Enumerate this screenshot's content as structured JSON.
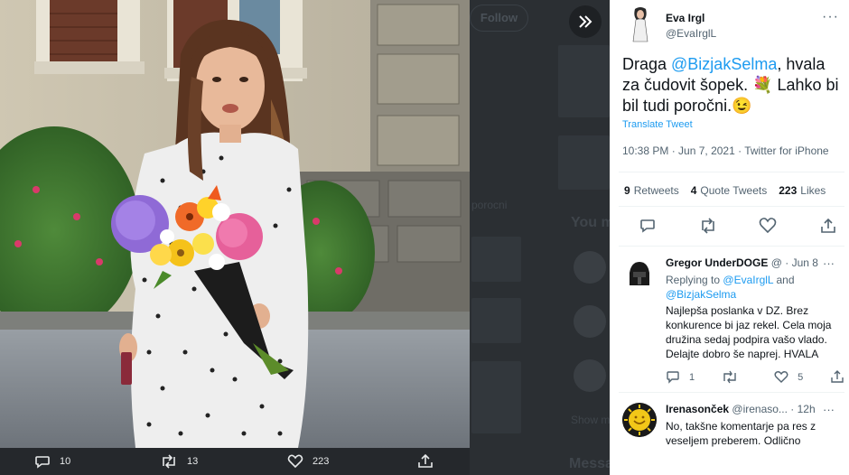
{
  "overlay": {
    "background_follow_label": "Follow",
    "background_text_1": "You m",
    "background_text_2": "Show m",
    "background_text_3": "Messa",
    "background_text_4": "porocni"
  },
  "media_bar": {
    "reply_count": "10",
    "retweet_count": "13",
    "like_count": "223"
  },
  "tweet": {
    "author_name": "Eva Irgl",
    "author_handle": "@EvaIrglL",
    "text_before": "Draga ",
    "mention": "@BizjakSelma",
    "text_after": ", hvala za čudovit šopek. 💐 Lahko bi bil tudi poročni.😉",
    "translate_label": "Translate Tweet",
    "time": "10:38 PM",
    "date": "Jun 7, 2021",
    "source": "Twitter for iPhone",
    "retweets_count": "9",
    "retweets_label": "Retweets",
    "quotes_count": "4",
    "quotes_label": "Quote Tweets",
    "likes_count": "223",
    "likes_label": "Likes"
  },
  "replies": [
    {
      "name": "Gregor UnderDOGE",
      "handle": "@",
      "date": "Jun 8",
      "replying_label": "Replying to",
      "replying_to_1": "@EvaIrglL",
      "replying_and": "and",
      "replying_to_2": "@BizjakSelma",
      "lines": [
        "Najlepša poslanka v DZ. Brez",
        "konkurence bi jaz rekel. Cela moja",
        "družina sedaj podpira vašo vlado.",
        "Delajte dobro še naprej. HVALA"
      ],
      "reply_count": "1",
      "retweet_count": "",
      "like_count": "5"
    },
    {
      "name": "Irenasonček",
      "handle": "@irenaso...",
      "date": "12h",
      "lines": [
        "No, takšne komentarje pa res z",
        "veseljem preberem. Odlično"
      ]
    }
  ],
  "colors": {
    "accent": "#1d9bf0",
    "overlay": "#25282c",
    "panel": "#ffffff"
  }
}
